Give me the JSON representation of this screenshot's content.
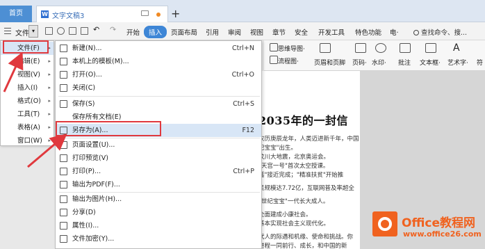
{
  "titlebar": {
    "home_tab": "首页",
    "doc_tab": "文字文稿3",
    "doc_icon": "W"
  },
  "menubar": {
    "file_label": "文件",
    "tabs": [
      "开始",
      "插入",
      "页面布局",
      "引用",
      "审阅",
      "视图",
      "章节",
      "安全",
      "开发工具",
      "特色功能",
      "电·"
    ],
    "active_tab": "插入",
    "search_placeholder": "查找命令、搜..."
  },
  "ribbon": {
    "items": [
      "思维导图·",
      "流程图·",
      "页眉和页脚",
      "页码·",
      "水印·",
      "批注",
      "文本框·",
      "艺术字·",
      "符"
    ]
  },
  "file_menu": {
    "items": [
      {
        "label": "文件(F)"
      },
      {
        "label": "编辑(E)"
      },
      {
        "label": "视图(V)"
      },
      {
        "label": "插入(I)"
      },
      {
        "label": "格式(O)"
      },
      {
        "label": "工具(T)"
      },
      {
        "label": "表格(A)"
      },
      {
        "label": "窗口(W)"
      }
    ]
  },
  "file_submenu": {
    "items": [
      {
        "label": "新建(N)...",
        "shortcut": "Ctrl+N"
      },
      {
        "label": "本机上的模板(M)...",
        "shortcut": ""
      },
      {
        "label": "打开(O)...",
        "shortcut": "Ctrl+O"
      },
      {
        "label": "关闭(C)",
        "shortcut": ""
      },
      {
        "label": "保存(S)",
        "shortcut": "Ctrl+S"
      },
      {
        "label": "保存所有文档(E)",
        "shortcut": ""
      },
      {
        "label": "另存为(A)...",
        "shortcut": "F12"
      },
      {
        "label": "页面设置(U)...",
        "shortcut": ""
      },
      {
        "label": "打印预览(V)",
        "shortcut": ""
      },
      {
        "label": "打印(P)...",
        "shortcut": "Ctrl+P"
      },
      {
        "label": "输出为PDF(F)...",
        "shortcut": ""
      },
      {
        "label": "输出为图片(H)...",
        "shortcut": ""
      },
      {
        "label": "分享(D)",
        "shortcut": ""
      },
      {
        "label": "属性(I)...",
        "shortcut": ""
      },
      {
        "label": "文件加密(Y)...",
        "shortcut": ""
      }
    ]
  },
  "document": {
    "heading": "2035年的一封信",
    "lines": [
      "农历庚辰龙年，人类迈进新千年，中国",
      "纪宝宝\"出生。",
      "汶川大地震，北京奥运会。",
      "\"天宫一号\"首次太空授课。",
      "遥\"接近完成；\"精准扶贫\"开始推",
      "民规模达7.72亿，互联网普及率超全",
      "\"世纪宝宝\"一代长大成人。",
      "全面建成小康社会。",
      "基本实现社会主义现代化。",
      "代人的际遇和机缘、使命和挑战。你",
      "进程一同前行、成长，和中国的新"
    ]
  },
  "watermark": {
    "title": "Office教程网",
    "url": "www.office26.com"
  }
}
